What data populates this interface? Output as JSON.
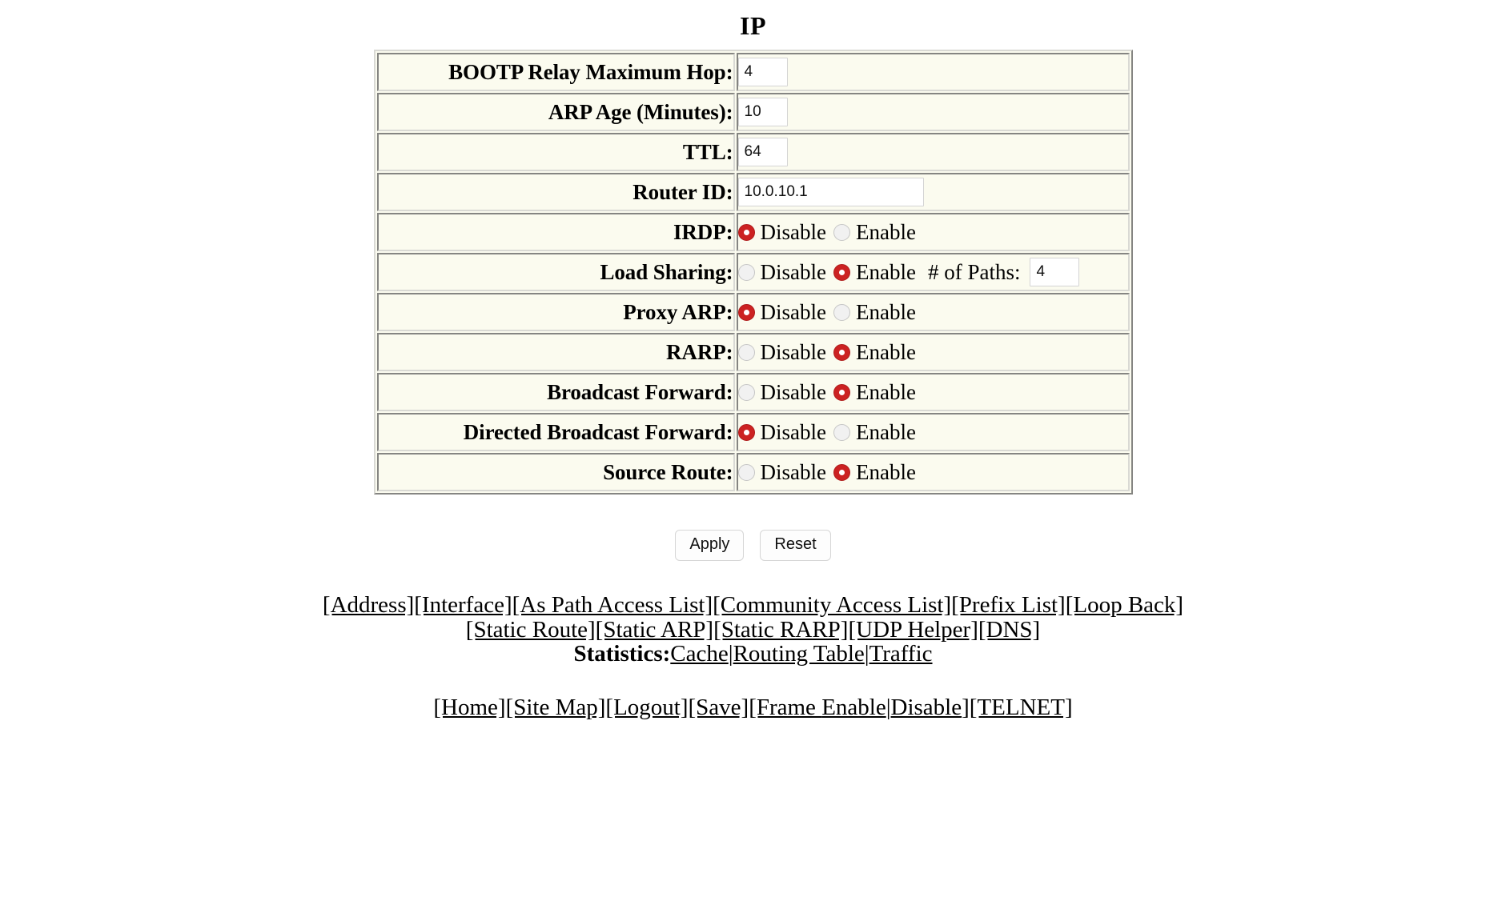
{
  "page": {
    "title": "IP"
  },
  "form": {
    "rows": [
      {
        "label": "BOOTP Relay Maximum Hop:",
        "kind": "text",
        "value": "4",
        "width": "small"
      },
      {
        "label": "ARP Age (Minutes):",
        "kind": "text",
        "value": "10",
        "width": "small"
      },
      {
        "label": "TTL:",
        "kind": "text",
        "value": "64",
        "width": "small"
      },
      {
        "label": "Router ID:",
        "kind": "text",
        "value": "10.0.10.1",
        "width": "ip"
      },
      {
        "label": "IRDP:",
        "kind": "radio",
        "options": [
          "Disable",
          "Enable"
        ],
        "selected": "Disable"
      },
      {
        "label": "Load Sharing:",
        "kind": "radio-paths",
        "options": [
          "Disable",
          "Enable"
        ],
        "selected": "Enable",
        "paths_label": "# of Paths:",
        "paths_value": "4"
      },
      {
        "label": "Proxy ARP:",
        "kind": "radio",
        "options": [
          "Disable",
          "Enable"
        ],
        "selected": "Disable"
      },
      {
        "label": "RARP:",
        "kind": "radio",
        "options": [
          "Disable",
          "Enable"
        ],
        "selected": "Enable"
      },
      {
        "label": "Broadcast Forward:",
        "kind": "radio",
        "options": [
          "Disable",
          "Enable"
        ],
        "selected": "Enable"
      },
      {
        "label": "Directed Broadcast Forward:",
        "kind": "radio",
        "options": [
          "Disable",
          "Enable"
        ],
        "selected": "Disable"
      },
      {
        "label": "Source Route:",
        "kind": "radio",
        "options": [
          "Disable",
          "Enable"
        ],
        "selected": "Enable"
      }
    ]
  },
  "buttons": {
    "apply_label": "Apply",
    "reset_label": "Reset"
  },
  "nav": {
    "line1": [
      {
        "text": "[Address]"
      },
      {
        "text": "[Interface]"
      },
      {
        "text": "[As Path Access List]"
      },
      {
        "text": "[Community Access List]"
      },
      {
        "text": "[Prefix List]"
      },
      {
        "text": "[Loop Back]"
      }
    ],
    "line2": [
      {
        "text": "[Static Route]"
      },
      {
        "text": "[Static ARP]"
      },
      {
        "text": "[Static RARP]"
      },
      {
        "text": "[UDP Helper]"
      },
      {
        "text": "[DNS]"
      }
    ],
    "statistics_label": "Statistics:",
    "statistics_links": [
      {
        "text": "Cache"
      },
      {
        "text": "Routing Table"
      },
      {
        "text": "Traffic"
      }
    ],
    "statistics_separator": "|",
    "footer_prefix": [
      {
        "text": "[Home]"
      },
      {
        "text": "[Site Map]"
      },
      {
        "text": "[Logout]"
      },
      {
        "text": "[Save]"
      }
    ],
    "frame_open": "[Frame ",
    "frame_enable": "Enable",
    "frame_sep": "|",
    "frame_disable": "Disable",
    "frame_close": "]",
    "telnet": "[TELNET]"
  },
  "colors": {
    "table_background": "#fbfbef",
    "radio_selected": "#cc2222",
    "radio_unselected": "#f1f1f1",
    "text": "#000000"
  }
}
